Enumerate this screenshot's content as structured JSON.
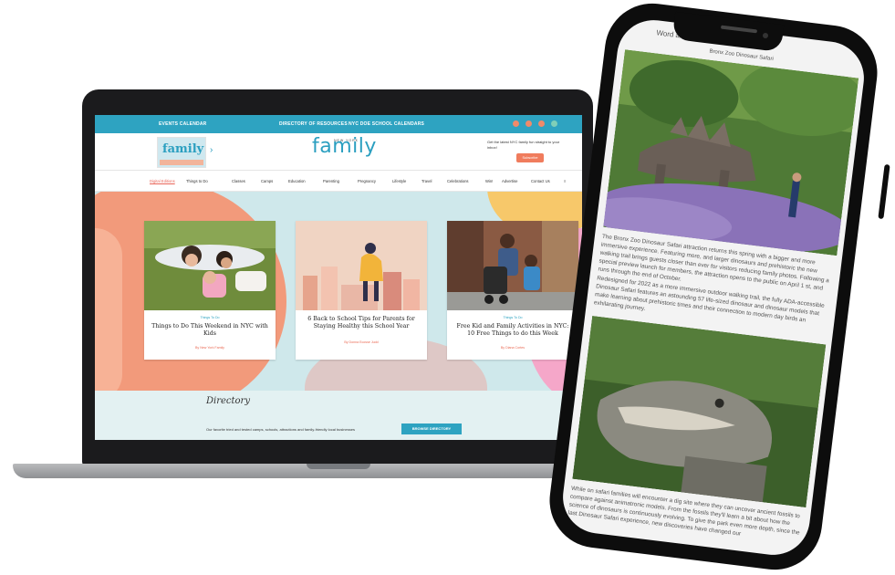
{
  "laptop": {
    "topbar": {
      "events": "EVENTS CALENDAR",
      "directory": "DIRECTORY OF RESOURCES",
      "schools": "NYC DOE SCHOOL CALENDARS"
    },
    "header": {
      "magazine_title": "family",
      "logo": "family",
      "logo_sub": "NEW YORK",
      "promo": "Get the latest NYC family fun straight to your inbox!",
      "subscribe": "Subscribe"
    },
    "nav": [
      "Digital Editions",
      "Things to Do",
      "Classes",
      "Camps",
      "Education",
      "Parenting",
      "Pregnancy",
      "Lifestyle",
      "Travel",
      "Celebrations",
      "Win!",
      "Advertise",
      "Contact Us"
    ],
    "cards": [
      {
        "category": "Things To Do",
        "title": "Things to Do This Weekend in NYC with Kids",
        "byline": "By New York Family"
      },
      {
        "category": "",
        "title": "6 Back to School Tips for Parents for Staying Healthy this School Year",
        "byline": "By Donna Ecosse Judd"
      },
      {
        "category": "Things To Do",
        "title": "Free Kid and Family Activities in NYC: 10 Free Things to do this Week",
        "byline": "By Diana Cortes"
      }
    ],
    "directory": {
      "title": "Directory",
      "text": "Our favorite tried and tested camps, schools, attractions and family-friendly local businesses",
      "button": "BROWSE DIRECTORY"
    }
  },
  "phone": {
    "top_text": "Word amongst ... dinosaurs at the",
    "caption": "Bronx Zoo Dinosaur Safari",
    "para1": "The Bronx Zoo Dinosaur Safari attraction returns this spring with a bigger and more immersive experience. Featuring more, and larger dinosaurs and prehistoric the new walking trail brings guests closer than ever for visitors reducing family photos. Following a special preview launch for members, the attraction opens to the public on April 1 st, and runs through the end of October.",
    "para2": "Redesigned for 2022 as a more immersive outdoor walking trail, the fully ADA-accessible Dinosaur Safari features an astounding 57 life-sized dinosaur and dinosaur models that make learning about prehistoric times and their connection to modern day birds an exhilarating journey.",
    "para3": "While on safari families will encounter a dig site where they can uncover ancient fossils to compare against animatronic models. From the fossils they'll learn a bit about how the science of dinosaurs is continuously evolving. To give the park even more depth, since the last Dinosaur Safari experience, new discoveries have changed our"
  },
  "colors": {
    "brand_teal": "#2ea3c1",
    "accent_coral": "#f07c5d",
    "hero_bg": "#cfe8eb"
  }
}
